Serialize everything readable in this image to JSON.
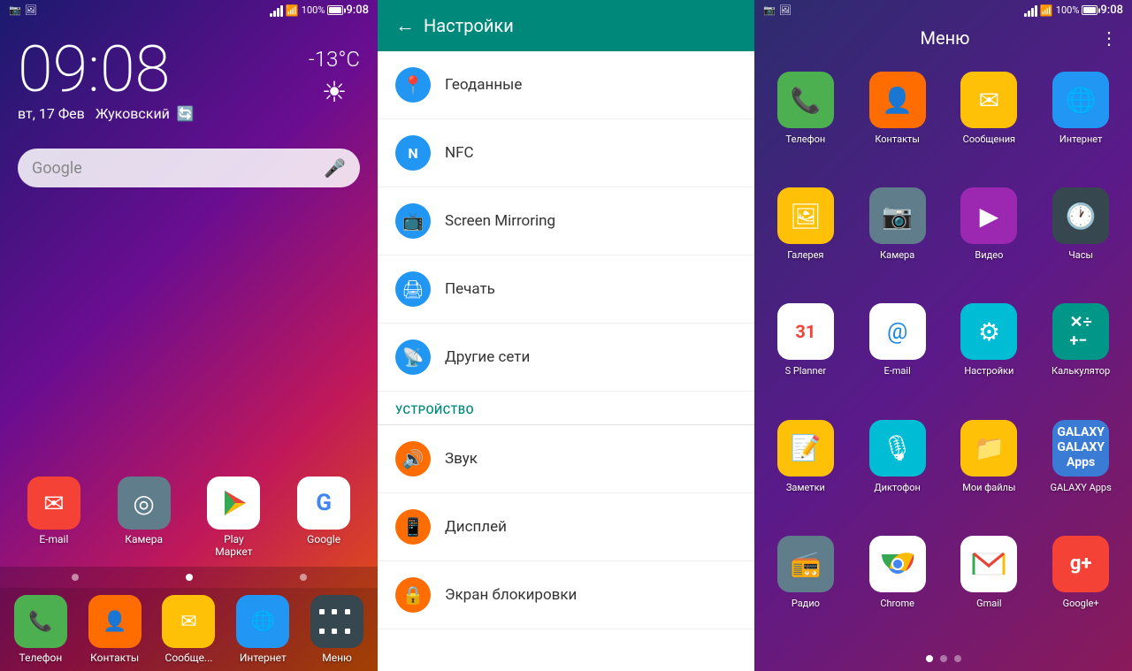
{
  "panel1": {
    "status": {
      "time": "9:08",
      "signal": "100%",
      "battery": "100%"
    },
    "clock": "09:08",
    "date": "вт, 17 Фев",
    "city": "Жуковский",
    "temp": "-13°C",
    "search_placeholder": "Google",
    "apps": [
      {
        "label": "E-mail",
        "icon": "✉",
        "color": "ic-red"
      },
      {
        "label": "Камера",
        "icon": "◎",
        "color": "ic-grey"
      },
      {
        "label": "Play Маркет",
        "icon": "▶",
        "color": "ic-white"
      },
      {
        "label": "Google",
        "icon": "G",
        "color": "ic-white"
      }
    ],
    "dock": [
      {
        "label": "Телефон",
        "icon": "📞",
        "color": "ic-green"
      },
      {
        "label": "Контакты",
        "icon": "👤",
        "color": "ic-orange"
      },
      {
        "label": "Сообще...",
        "icon": "✉",
        "color": "ic-amber"
      },
      {
        "label": "Интернет",
        "icon": "🌐",
        "color": "ic-blue"
      },
      {
        "label": "Меню",
        "icon": "⋮⋮",
        "color": "ic-dark"
      }
    ]
  },
  "panel2": {
    "title": "Настройки",
    "items_connectivity": [
      {
        "icon": "📍",
        "color": "blue",
        "label": "Геоданные"
      },
      {
        "icon": "N",
        "color": "blue",
        "label": "NFC"
      },
      {
        "icon": "📺",
        "color": "blue",
        "label": "Screen Mirroring"
      },
      {
        "icon": "🖨",
        "color": "blue",
        "label": "Печать"
      },
      {
        "icon": "📡",
        "color": "blue",
        "label": "Другие сети"
      }
    ],
    "section_device": "УСТРОЙСТВО",
    "items_device": [
      {
        "icon": "🔊",
        "color": "orange",
        "label": "Звук"
      },
      {
        "icon": "📱",
        "color": "orange",
        "label": "Дисплей"
      },
      {
        "icon": "🔒",
        "color": "orange",
        "label": "Экран блокировки"
      }
    ]
  },
  "panel3": {
    "title": "Меню",
    "more_icon": "⋮",
    "apps": [
      {
        "label": "Телефон",
        "icon": "📞",
        "color": "ic-green"
      },
      {
        "label": "Контакты",
        "icon": "👤",
        "color": "ic-orange"
      },
      {
        "label": "Сообщения",
        "icon": "✉",
        "color": "ic-amber"
      },
      {
        "label": "Интернет",
        "icon": "🌐",
        "color": "ic-blue"
      },
      {
        "label": "Галерея",
        "icon": "🖼",
        "color": "ic-amber"
      },
      {
        "label": "Камера",
        "icon": "📷",
        "color": "ic-grey"
      },
      {
        "label": "Видео",
        "icon": "▶",
        "color": "ic-purple"
      },
      {
        "label": "Часы",
        "icon": "🕐",
        "color": "ic-dark"
      },
      {
        "label": "S Planner",
        "icon": "31",
        "color": "ic-white"
      },
      {
        "label": "E-mail",
        "icon": "@",
        "color": "ic-white"
      },
      {
        "label": "Настройки",
        "icon": "⚙",
        "color": "ic-cyan"
      },
      {
        "label": "Калькулятор",
        "icon": "✕÷",
        "color": "ic-teal"
      },
      {
        "label": "Заметки",
        "icon": "📝",
        "color": "ic-amber"
      },
      {
        "label": "Диктофон",
        "icon": "🎙",
        "color": "ic-cyan"
      },
      {
        "label": "Мои файлы",
        "icon": "📁",
        "color": "ic-amber"
      },
      {
        "label": "GALAXY Apps",
        "icon": "G",
        "color": "ic-galaxy"
      },
      {
        "label": "Радио",
        "icon": "📻",
        "color": "ic-grey"
      },
      {
        "label": "Chrome",
        "icon": "C",
        "color": "ic-chrome"
      },
      {
        "label": "Gmail",
        "icon": "M",
        "color": "ic-gmail"
      },
      {
        "label": "Google+",
        "icon": "g+",
        "color": "ic-red"
      }
    ],
    "page_dots": [
      true,
      false,
      false
    ]
  }
}
